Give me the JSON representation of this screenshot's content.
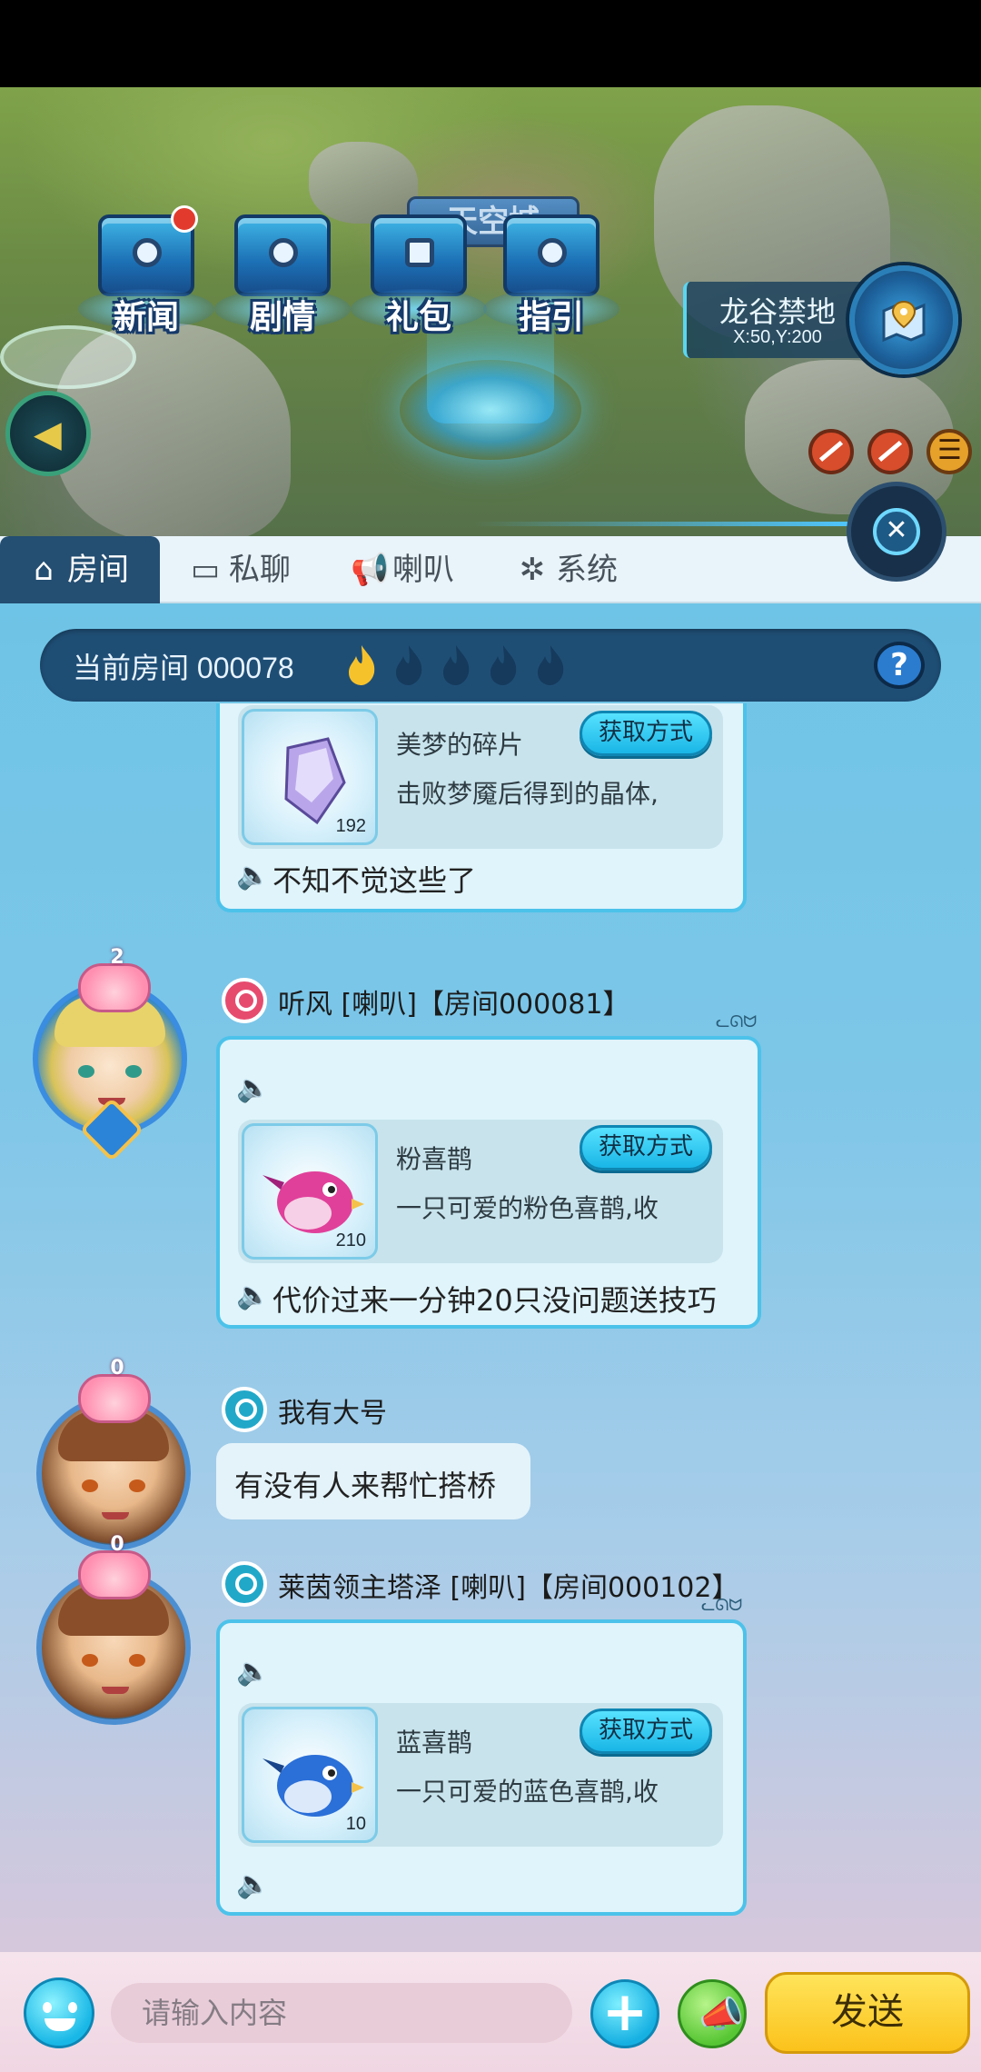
{
  "scene": {
    "menu": [
      {
        "label": "新闻",
        "icon": "news-tv-icon"
      },
      {
        "label": "剧情",
        "icon": "story-box-icon"
      },
      {
        "label": "礼包",
        "icon": "gift-pack-icon"
      },
      {
        "label": "指引",
        "icon": "guide-box-icon"
      }
    ],
    "signboard": "天空城",
    "location": {
      "name": "龙谷禁地",
      "coords": "X:50,Y:200"
    }
  },
  "chat": {
    "tabs": [
      {
        "label": "房间",
        "icon": "house-icon",
        "active": true
      },
      {
        "label": "私聊",
        "icon": "monitor-icon",
        "active": false
      },
      {
        "label": "喇叭",
        "icon": "megaphone-icon",
        "active": false
      },
      {
        "label": "系统",
        "icon": "pinwheel-icon",
        "active": false
      }
    ],
    "room": {
      "label": "当前房间 000078",
      "heat_level": 1,
      "heat_max": 5,
      "help": "?"
    },
    "messages": [
      {
        "sender": "",
        "item": {
          "name": "美梦的碎片",
          "desc": "击败梦魇后得到的晶体,",
          "count": "192",
          "button": "获取方式"
        },
        "text": "不知不觉这些了"
      },
      {
        "sender": "听风 [喇叭]【房间000081】",
        "gender": "female",
        "avatar_level": "2",
        "item": {
          "name": "粉喜鹊",
          "desc": "一只可爱的粉色喜鹊,收",
          "count": "210",
          "button": "获取方式"
        },
        "text": "代价过来一分钟20只没问题送技巧"
      },
      {
        "sender": "我有大号",
        "gender": "male",
        "avatar_level": "0",
        "text": "有没有人来帮忙搭桥"
      },
      {
        "sender": "莱茵领主塔泽 [喇叭]【房间000102】",
        "gender": "male",
        "avatar_level": "0",
        "item": {
          "name": "蓝喜鹊",
          "desc": "一只可爱的蓝色喜鹊,收",
          "count": "10",
          "button": "获取方式"
        },
        "text": ""
      }
    ]
  },
  "input": {
    "placeholder": "请输入内容",
    "send_label": "发送",
    "plus_label": "+"
  },
  "colors": {
    "tab_active": "#244e72",
    "bubble_border": "#4cc2ea",
    "send_button": "#fbc21b",
    "room_bar": "#1f4e75"
  }
}
